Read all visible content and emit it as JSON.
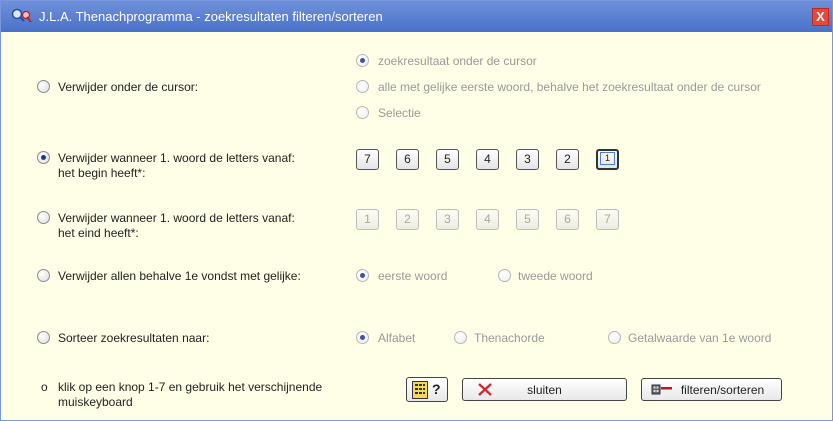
{
  "window": {
    "title": "J.L.A. Thenachprogramma - zoekresultaten filteren/sorteren",
    "close_label": "X"
  },
  "options": {
    "remove_cursor": {
      "label": "Verwijder onder de cursor:",
      "suboptions": [
        "zoekresultaat onder de cursor",
        "alle met gelijke eerste woord, behalve het zoekresultaat onder de cursor",
        "Selectie"
      ]
    },
    "remove_begin": {
      "line1": "Verwijder wanneer 1. woord de letters vanaf:",
      "line2": "het begin heeft*:",
      "buttons": [
        "7",
        "6",
        "5",
        "4",
        "3",
        "2",
        "1"
      ]
    },
    "remove_end": {
      "line1": "Verwijder wanneer 1. woord de letters vanaf:",
      "line2": "het eind heeft*:",
      "buttons": [
        "1",
        "2",
        "3",
        "4",
        "5",
        "6",
        "7"
      ]
    },
    "remove_all": {
      "label": "Verwijder allen behalve 1e vondst met gelijke:",
      "suboptions": [
        "eerste woord",
        "tweede woord"
      ]
    },
    "sort": {
      "label": "Sorteer zoekresultaten naar:",
      "suboptions": [
        "Alfabet",
        "Thenachorde",
        "Getalwaarde van 1e woord"
      ]
    }
  },
  "footer": {
    "note_bullet": "o",
    "note_line1": "klik op een knop 1-7 en gebruik het verschijnende",
    "note_line2": "muiskeyboard",
    "help_label": "?",
    "close_label": "sluiten",
    "filter_label": "filteren/sorteren"
  },
  "colors": {
    "titlebar": "#4a72c9",
    "background": "#fffee6",
    "accent_red": "#e8483a"
  }
}
